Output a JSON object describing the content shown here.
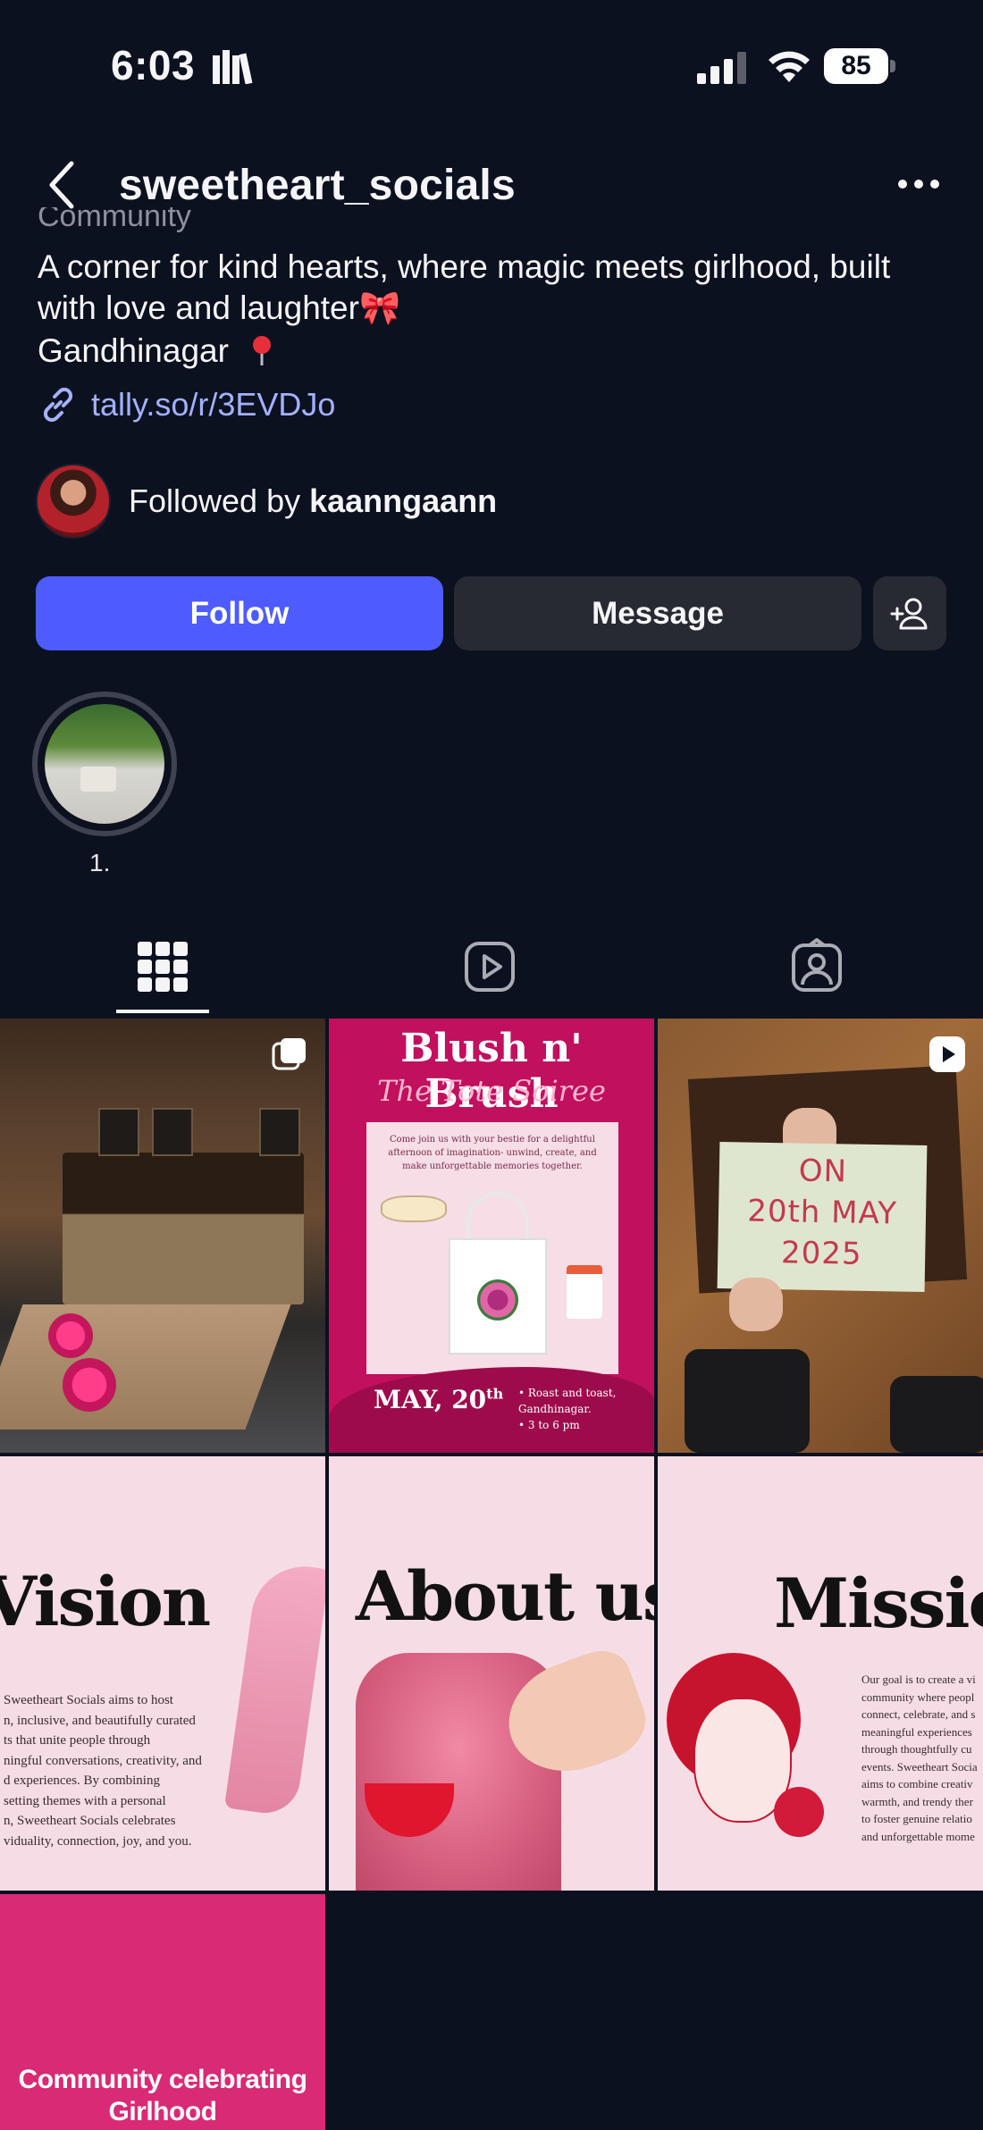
{
  "status_bar": {
    "time": "6:03",
    "battery": "85"
  },
  "header": {
    "username": "sweetheart_socials"
  },
  "bio": {
    "category": "Community",
    "text": "A corner for kind hearts, where magic meets girlhood, built with love and laughter🎀",
    "location": "Gandhinagar",
    "link": "tally.so/r/3EVDJo"
  },
  "followed_by": {
    "prefix": "Followed by ",
    "name": "kaanngaann"
  },
  "actions": {
    "follow_label": "Follow",
    "message_label": "Message"
  },
  "highlights": [
    {
      "label": "1."
    }
  ],
  "tabs": [
    {
      "icon": "grid-icon",
      "selected": true
    },
    {
      "icon": "reels-icon",
      "selected": false
    },
    {
      "icon": "tagged-icon",
      "selected": false
    }
  ],
  "posts": {
    "p2": {
      "title": "Blush n' Brush",
      "subtitle": "The Tote Soiree",
      "body": "Come join us with your bestie for a delightful afternoon of imagination- unwind, create, and make unforgettable memories together.",
      "date_main": "MAY, 20",
      "date_sup": "th",
      "details_1": "• Roast and toast,",
      "details_2": "Gandhinagar.",
      "details_3": "• 3 to 6 pm"
    },
    "p3": {
      "line1": "ON",
      "line2": "20th MAY",
      "line3": "2025"
    },
    "p4": {
      "title": "Vision",
      "para_lines": [
        "Sweetheart Socials aims to host",
        "n, inclusive, and beautifully curated",
        "ts that unite people through",
        "ningful conversations, creativity, and",
        "d experiences. By combining",
        "setting themes with a personal",
        "n, Sweetheart Socials celebrates",
        "viduality, connection, joy, and you."
      ]
    },
    "p5": {
      "title": "About us"
    },
    "p6": {
      "title": "Mission",
      "para_lines": [
        "Our goal is to create a vi",
        "community where peopl",
        "connect, celebrate, and s",
        "meaningful experiences",
        "through thoughtfully cu",
        "events. Sweetheart Socia",
        "aims to combine creativ",
        "warmth, and trendy ther",
        "to foster genuine relatio",
        "and unforgettable mome"
      ]
    },
    "p7": {
      "line1": "Community celebrating",
      "line2": "Girlhood"
    }
  },
  "colors": {
    "background": "#0c1120",
    "follow_button": "#4d5bff",
    "secondary_button": "#272a33",
    "link": "#a3b1ff"
  }
}
